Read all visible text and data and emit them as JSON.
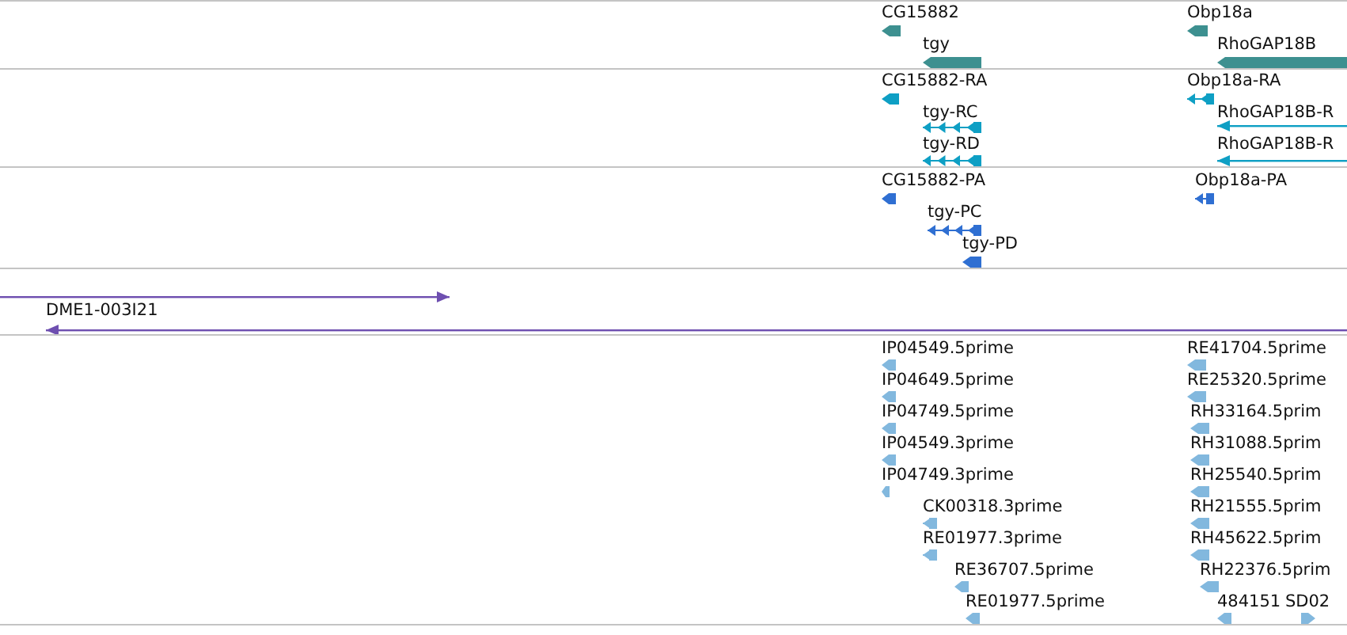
{
  "tracks": [
    {
      "kind": "gene",
      "color": "#3d9090",
      "features": [
        {
          "label": "CG15882",
          "reverse": true
        },
        {
          "label": "tgy",
          "reverse": true
        },
        {
          "label": "Obp18a",
          "reverse": true
        },
        {
          "label": "RhoGAP18B",
          "reverse": true
        }
      ]
    },
    {
      "kind": "transcript",
      "color": "#0e9fc4",
      "features": [
        {
          "label": "CG15882-RA",
          "reverse": true
        },
        {
          "label": "tgy-RC",
          "reverse": true
        },
        {
          "label": "tgy-RD",
          "reverse": true
        },
        {
          "label": "Obp18a-RA",
          "reverse": true
        },
        {
          "label": "RhoGAP18B-R",
          "reverse": true
        },
        {
          "label": "RhoGAP18B-R",
          "reverse": true
        }
      ]
    },
    {
      "kind": "protein",
      "color": "#2f6fd2",
      "features": [
        {
          "label": "CG15882-PA",
          "reverse": true
        },
        {
          "label": "tgy-PC",
          "reverse": true
        },
        {
          "label": "tgy-PD",
          "reverse": true
        },
        {
          "label": "Obp18a-PA",
          "reverse": true
        }
      ]
    },
    {
      "kind": "clone",
      "color": "#6e4fb0",
      "features": [
        {
          "reverse": false
        },
        {
          "label": "DME1-003I21",
          "reverse": true
        }
      ]
    },
    {
      "kind": "est",
      "color": "#82b8de",
      "features": [
        {
          "label": "IP04549.5prime",
          "reverse": true
        },
        {
          "label": "IP04649.5prime",
          "reverse": true
        },
        {
          "label": "IP04749.5prime",
          "reverse": true
        },
        {
          "label": "IP04549.3prime",
          "reverse": true
        },
        {
          "label": "IP04749.3prime",
          "reverse": true
        },
        {
          "label": "CK00318.3prime",
          "reverse": true
        },
        {
          "label": "RE01977.3prime",
          "reverse": true
        },
        {
          "label": "RE36707.5prime",
          "reverse": true
        },
        {
          "label": "RE01977.5prime",
          "reverse": true
        },
        {
          "label": "RE41704.5prime",
          "reverse": true
        },
        {
          "label": "RE25320.5prime",
          "reverse": true
        },
        {
          "label": "RH33164.5prim",
          "reverse": true
        },
        {
          "label": "RH31088.5prim",
          "reverse": true
        },
        {
          "label": "RH25540.5prim",
          "reverse": true
        },
        {
          "label": "RH21555.5prim",
          "reverse": true
        },
        {
          "label": "RH45622.5prim",
          "reverse": true
        },
        {
          "label": "RH22376.5prim",
          "reverse": true
        },
        {
          "label": "484151",
          "reverse": true
        },
        {
          "label": "SD02",
          "reverse": false
        }
      ]
    }
  ]
}
